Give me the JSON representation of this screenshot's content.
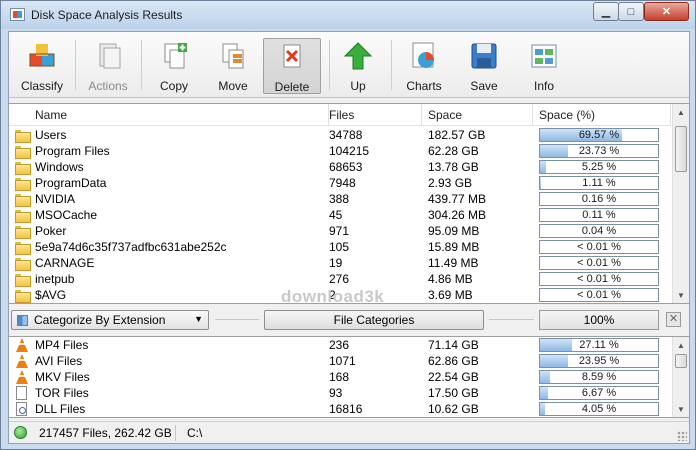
{
  "window": {
    "title": "Disk Space Analysis Results"
  },
  "toolbar": [
    {
      "label": "Classify",
      "icon": "classify-icon",
      "disabled": false
    },
    {
      "label": "Actions",
      "icon": "actions-icon",
      "disabled": true
    },
    {
      "label": "Copy",
      "icon": "copy-icon",
      "disabled": false
    },
    {
      "label": "Move",
      "icon": "move-icon",
      "disabled": false
    },
    {
      "label": "Delete",
      "icon": "delete-icon",
      "disabled": false,
      "pressed": true
    },
    {
      "label": "Up",
      "icon": "up-arrow-icon",
      "disabled": false
    },
    {
      "label": "Charts",
      "icon": "charts-icon",
      "disabled": false
    },
    {
      "label": "Save",
      "icon": "save-icon",
      "disabled": false
    },
    {
      "label": "Info",
      "icon": "info-icon",
      "disabled": false
    }
  ],
  "columns": {
    "name": "Name",
    "files": "Files",
    "space": "Space",
    "space_pct": "Space (%)"
  },
  "folders": [
    {
      "name": "Users",
      "files": "34788",
      "space": "182.57 GB",
      "pct_label": "69.57 %",
      "pct": 69.57
    },
    {
      "name": "Program Files",
      "files": "104215",
      "space": "62.28 GB",
      "pct_label": "23.73 %",
      "pct": 23.73
    },
    {
      "name": "Windows",
      "files": "68653",
      "space": "13.78 GB",
      "pct_label": "5.25 %",
      "pct": 5.25
    },
    {
      "name": "ProgramData",
      "files": "7948",
      "space": "2.93 GB",
      "pct_label": "1.11 %",
      "pct": 1.11
    },
    {
      "name": "NVIDIA",
      "files": "388",
      "space": "439.77 MB",
      "pct_label": "0.16 %",
      "pct": 0.16
    },
    {
      "name": "MSOCache",
      "files": "45",
      "space": "304.26 MB",
      "pct_label": "0.11 %",
      "pct": 0.11
    },
    {
      "name": "Poker",
      "files": "971",
      "space": "95.09 MB",
      "pct_label": "0.04 %",
      "pct": 0.04
    },
    {
      "name": "5e9a74d6c35f737adfbc631abe252c",
      "files": "105",
      "space": "15.89 MB",
      "pct_label": "< 0.01 %",
      "pct": 0.0
    },
    {
      "name": "CARNAGE",
      "files": "19",
      "space": "11.49 MB",
      "pct_label": "< 0.01 %",
      "pct": 0.0
    },
    {
      "name": "inetpub",
      "files": "276",
      "space": "4.86 MB",
      "pct_label": "< 0.01 %",
      "pct": 0.0
    },
    {
      "name": "$AVG",
      "files": "2",
      "space": "3.69 MB",
      "pct_label": "< 0.01 %",
      "pct": 0.0
    }
  ],
  "category_bar": {
    "dropdown_value": "Categorize By Extension",
    "categories_button": "File Categories",
    "total_pct": "100%",
    "close_label": "✕"
  },
  "extensions": [
    {
      "name": "MP4 Files",
      "files": "236",
      "space": "71.14 GB",
      "pct_label": "27.11 %",
      "pct": 27.11,
      "icon": "vlc-cone-icon"
    },
    {
      "name": "AVI Files",
      "files": "1071",
      "space": "62.86 GB",
      "pct_label": "23.95 %",
      "pct": 23.95,
      "icon": "vlc-cone-icon"
    },
    {
      "name": "MKV Files",
      "files": "168",
      "space": "22.54 GB",
      "pct_label": "8.59 %",
      "pct": 8.59,
      "icon": "vlc-cone-icon"
    },
    {
      "name": "TOR Files",
      "files": "93",
      "space": "17.50 GB",
      "pct_label": "6.67 %",
      "pct": 6.67,
      "icon": "blank-file-icon"
    },
    {
      "name": "DLL Files",
      "files": "16816",
      "space": "10.62 GB",
      "pct_label": "4.05 %",
      "pct": 4.05,
      "icon": "dll-file-icon"
    }
  ],
  "status": {
    "summary": "217457 Files, 262.42 GB",
    "path": "C:\\"
  },
  "watermark": "download3k",
  "colors": {
    "bar_fill": "#8fb8e3",
    "titlebar": "#bcd2ea",
    "close_button": "#c5402d"
  }
}
